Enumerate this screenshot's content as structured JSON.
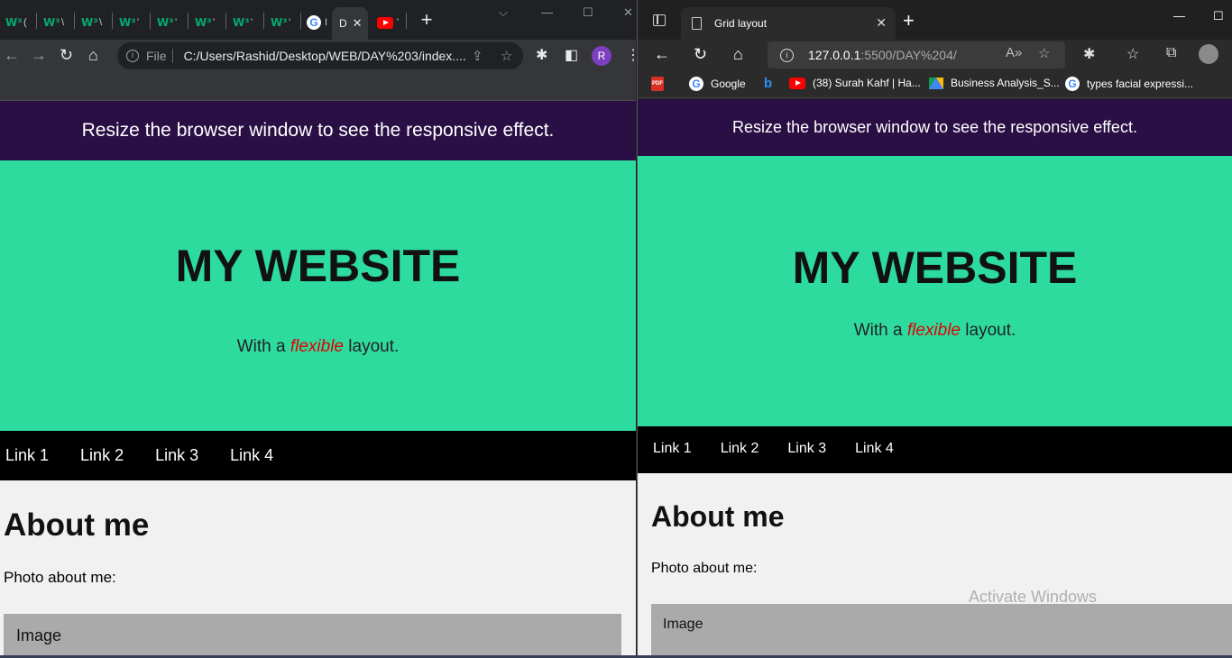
{
  "left_browser": {
    "tabs": [
      {
        "favicon": "w3schools-icon",
        "frag": "W³",
        "label": "("
      },
      {
        "favicon": "w3schools-icon",
        "frag": "W³",
        "label": "\\"
      },
      {
        "favicon": "w3schools-icon",
        "frag": "W³",
        "label": "\\"
      },
      {
        "favicon": "w3schools-icon",
        "frag": "W³",
        "label": "'"
      },
      {
        "favicon": "w3schools-icon",
        "frag": "W³",
        "label": "'"
      },
      {
        "favicon": "w3schools-icon",
        "frag": "W³",
        "label": "'"
      },
      {
        "favicon": "w3schools-icon",
        "frag": "W³",
        "label": "'"
      },
      {
        "favicon": "w3schools-icon",
        "frag": "W³",
        "label": "'"
      },
      {
        "favicon": "google-icon",
        "frag": "G",
        "label": "I"
      }
    ],
    "active_tab_label": "D",
    "youtube_tab_label": "'",
    "omnibox": {
      "scheme_label": "File",
      "url": "C:/Users/Rashid/Desktop/WEB/DAY%203/index...."
    },
    "avatar_letter": "R"
  },
  "right_browser": {
    "tab_title": "Grid layout",
    "url_host": "127.0.0.1",
    "url_rest": ":5500/DAY%204/",
    "bookmarks": [
      {
        "icon": "pdf-icon",
        "label": ""
      },
      {
        "icon": "google-icon",
        "label": "Google"
      },
      {
        "icon": "bing-icon",
        "label": ""
      },
      {
        "icon": "youtube-icon",
        "label": "(38) Surah Kahf | Ha..."
      },
      {
        "icon": "google-drive-icon",
        "label": "Business Analysis_S..."
      },
      {
        "icon": "google-icon",
        "label": "types facial expressi..."
      }
    ]
  },
  "site": {
    "banner": "Resize the browser window to see the responsive effect.",
    "title": "MY WEBSITE",
    "subtitle_pre": "With a ",
    "subtitle_em": "flexible",
    "subtitle_post": " layout.",
    "nav_links": [
      "Link 1",
      "Link 2",
      "Link 3",
      "Link 4"
    ],
    "about_heading": "About me",
    "photo_label": "Photo about me:",
    "image_placeholder": "Image"
  },
  "watermark": "Activate Windows",
  "colors": {
    "banner_bg": "#2a0f45",
    "hero_bg": "#2edb9e",
    "nav_bg": "#000000",
    "emphasis": "#e10000",
    "image_box": "#aaaaaa"
  }
}
